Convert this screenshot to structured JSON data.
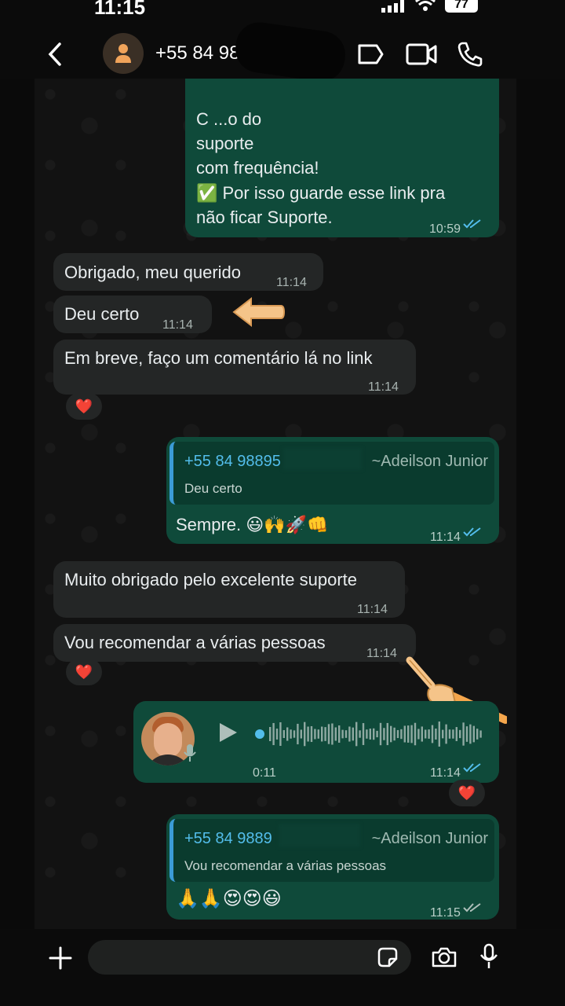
{
  "status": {
    "time": "11:15",
    "battery": "77"
  },
  "header": {
    "contact": "+55 84 9885"
  },
  "messages": {
    "m1": {
      "line1": "C                          ...o do",
      "line2": "suporte",
      "line3": "com frequência!",
      "line4": "✅ Por isso guarde esse link pra",
      "line5": "não ficar Suporte.",
      "time": "10:59"
    },
    "m2": {
      "text": "Obrigado, meu querido",
      "time": "11:14"
    },
    "m3": {
      "text": "Deu certo",
      "time": "11:14"
    },
    "m4": {
      "text": "Em breve, faço um comentário lá no link",
      "time": "11:14",
      "reaction": "❤️"
    },
    "m5": {
      "reply_author": "+55 84 98895",
      "reply_suffix": "~Adeilson Junior",
      "reply_text": "Deu certo",
      "text": "Sempre. 😃🙌🚀👊",
      "time": "11:14"
    },
    "m6": {
      "text": "Muito obrigado pelo excelente suporte",
      "time": "11:14"
    },
    "m7": {
      "text": "Vou recomendar a várias pessoas",
      "time": "11:14",
      "reaction": "❤️"
    },
    "m8": {
      "duration": "0:11",
      "time": "11:14",
      "reaction": "❤️"
    },
    "m9": {
      "reply_author": "+55 84 9889",
      "reply_suffix": "~Adeilson Junior",
      "reply_text": "Vou recomendar a várias pessoas",
      "text": "🙏🙏😍😍😃",
      "time": "11:15"
    }
  },
  "colors": {
    "outgoing": "#0f4a3a",
    "incoming": "#242626",
    "read_ticks": "#53bdeb"
  }
}
